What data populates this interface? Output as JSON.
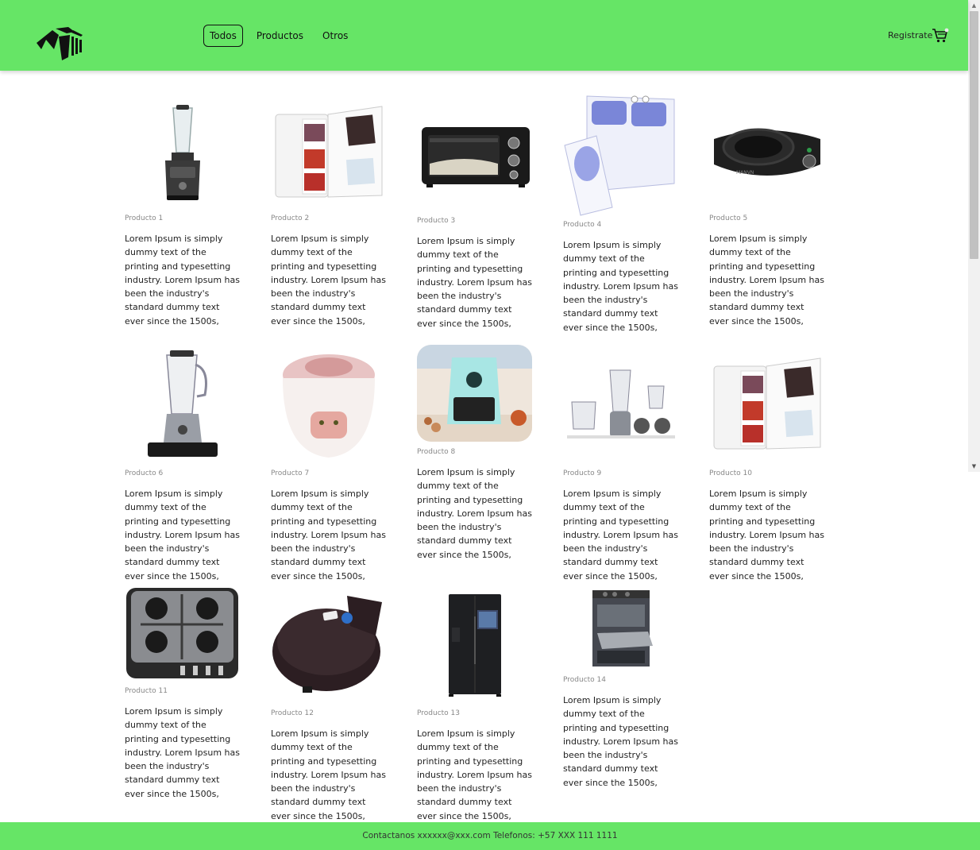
{
  "header": {
    "nav": [
      {
        "label": "Todos",
        "active": true
      },
      {
        "label": "Productos",
        "active": false
      },
      {
        "label": "Otros",
        "active": false
      }
    ],
    "register_label": "Registrate",
    "brand_color": "#66e566"
  },
  "products": [
    {
      "name": "Producto 1",
      "image": "blender-icon",
      "description": "Lorem Ipsum is simply dummy text of the printing and typesetting industry. Lorem Ipsum has been the industry's standard dummy text ever since the 1500s,"
    },
    {
      "name": "Producto 2",
      "image": "mini-fridge-icon",
      "description": "Lorem Ipsum is simply dummy text of the printing and typesetting industry. Lorem Ipsum has been the industry's standard dummy text ever since the 1500s,"
    },
    {
      "name": "Producto 3",
      "image": "toaster-oven-icon",
      "description": "Lorem Ipsum is simply dummy text of the printing and typesetting industry. Lorem Ipsum has been the industry's standard dummy text ever since the 1500s,"
    },
    {
      "name": "Producto 4",
      "image": "washing-machine-icon",
      "description": "Lorem Ipsum is simply dummy text of the printing and typesetting industry. Lorem Ipsum has been the industry's standard dummy text ever since the 1500s,"
    },
    {
      "name": "Producto 5",
      "image": "hot-plate-icon",
      "description": "Lorem Ipsum is simply dummy text of the printing and typesetting industry. Lorem Ipsum has been the industry's standard dummy text ever since the 1500s,"
    },
    {
      "name": "Producto 6",
      "image": "blender-icon",
      "description": "Lorem Ipsum is simply dummy text of the printing and typesetting industry. Lorem Ipsum has been the industry's standard dummy text ever since the 1500s,"
    },
    {
      "name": "Producto 7",
      "image": "rice-cooker-icon",
      "description": "Lorem Ipsum is simply dummy text of the printing and typesetting industry. Lorem Ipsum has been the industry's standard dummy text ever since the 1500s,"
    },
    {
      "name": "Producto 8",
      "image": "air-fryer-icon",
      "description": "Lorem Ipsum is simply dummy text of the printing and typesetting industry. Lorem Ipsum has been the industry's standard dummy text ever since the 1500s,"
    },
    {
      "name": "Producto 9",
      "image": "personal-blender-icon",
      "description": "Lorem Ipsum is simply dummy text of the printing and typesetting industry. Lorem Ipsum has been the industry's standard dummy text ever since the 1500s,"
    },
    {
      "name": "Producto 10",
      "image": "mini-fridge-icon",
      "description": "Lorem Ipsum is simply dummy text of the printing and typesetting industry. Lorem Ipsum has been the industry's standard dummy text ever since the 1500s,"
    },
    {
      "name": "Producto 11",
      "image": "gas-stovetop-icon",
      "description": "Lorem Ipsum is simply dummy text of the printing and typesetting industry. Lorem Ipsum has been the industry's standard dummy text ever since the 1500s,"
    },
    {
      "name": "Producto 12",
      "image": "waffle-maker-icon",
      "description": "Lorem Ipsum is simply dummy text of the printing and typesetting industry. Lorem Ipsum has been the industry's standard dummy text ever since the 1500s,"
    },
    {
      "name": "Producto 13",
      "image": "refrigerator-icon",
      "description": "Lorem Ipsum is simply dummy text of the printing and typesetting industry. Lorem Ipsum has been the industry's standard dummy text ever since the 1500s,"
    },
    {
      "name": "Producto 14",
      "image": "oven-stove-icon",
      "description": "Lorem Ipsum is simply dummy text of the printing and typesetting industry. Lorem Ipsum has been the industry's standard dummy text ever since the 1500s,"
    }
  ],
  "footer": {
    "text": "Contactanos xxxxxx@xxx.com Telefonos: +57 XXX 111 1111"
  }
}
